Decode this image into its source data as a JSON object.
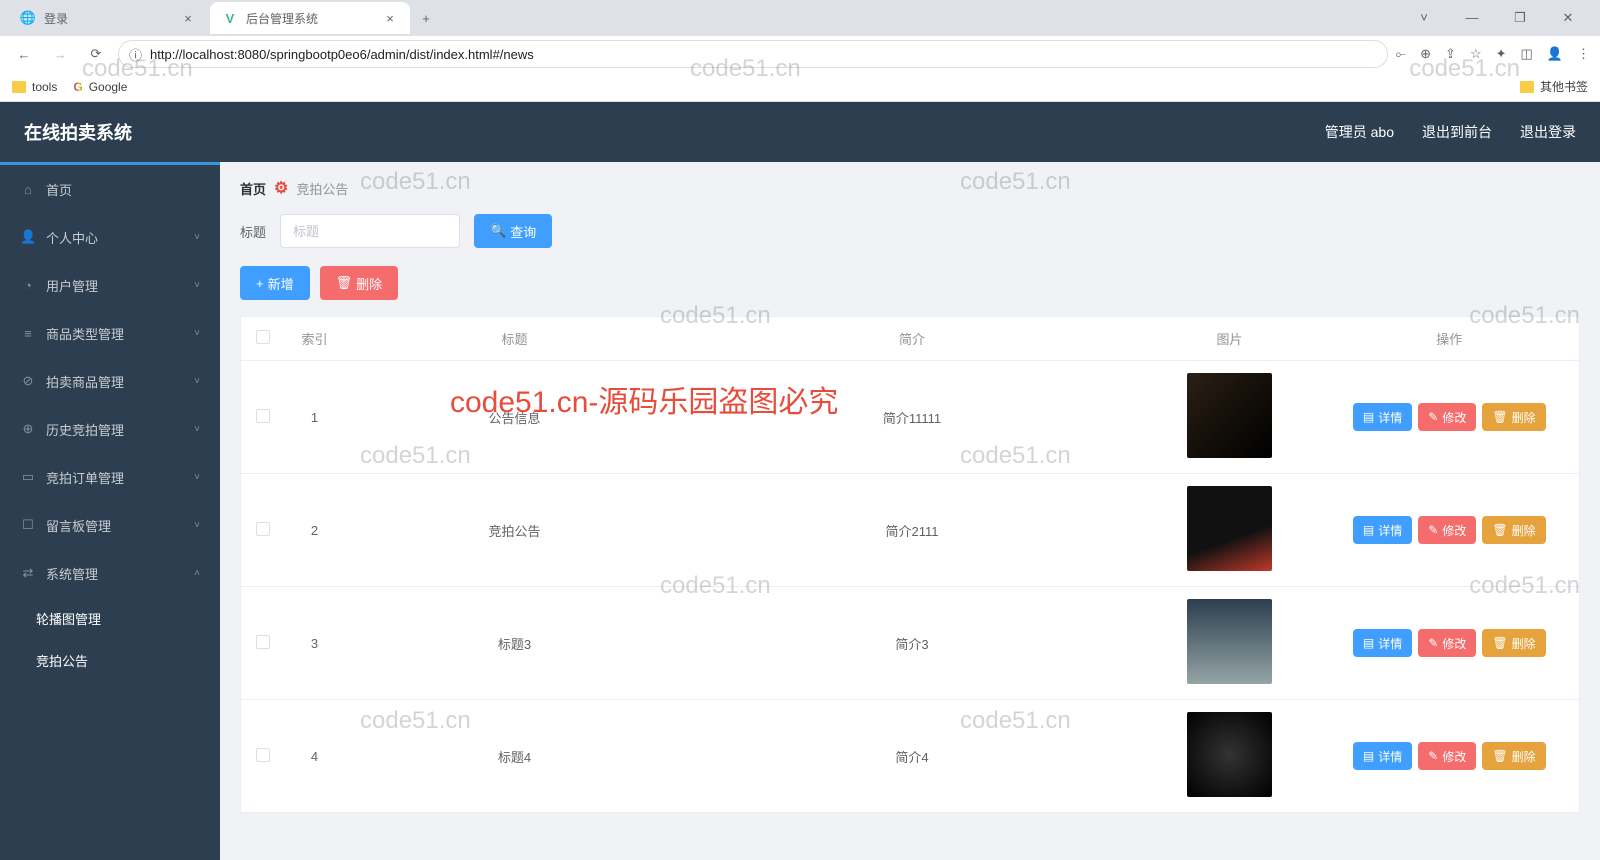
{
  "browser": {
    "tabs": [
      {
        "title": "登录",
        "active": false
      },
      {
        "title": "后台管理系统",
        "active": true
      }
    ],
    "url": "http://localhost:8080/springbootp0eo6/admin/dist/index.html#/news",
    "bookmarks": {
      "tools": "tools",
      "google": "Google",
      "other": "其他书签"
    }
  },
  "header": {
    "title": "在线拍卖系统",
    "user": "管理员 abo",
    "to_front": "退出到前台",
    "logout": "退出登录"
  },
  "sidebar": {
    "items": [
      {
        "label": "首页",
        "icon": "⌂"
      },
      {
        "label": "个人中心",
        "icon": "👤",
        "expand": true
      },
      {
        "label": "用户管理",
        "icon": "◔",
        "expand": true
      },
      {
        "label": "商品类型管理",
        "icon": "≡",
        "expand": true
      },
      {
        "label": "拍卖商品管理",
        "icon": "⊘",
        "expand": true
      },
      {
        "label": "历史竞拍管理",
        "icon": "⊕",
        "expand": true
      },
      {
        "label": "竞拍订单管理",
        "icon": "▭",
        "expand": true
      },
      {
        "label": "留言板管理",
        "icon": "☐",
        "expand": true
      },
      {
        "label": "系统管理",
        "icon": "⇄",
        "expand": true,
        "open": true
      }
    ],
    "subs": [
      {
        "label": "轮播图管理"
      },
      {
        "label": "竞拍公告"
      }
    ]
  },
  "breadcrumb": {
    "home": "首页",
    "current": "竞拍公告"
  },
  "search": {
    "label": "标题",
    "placeholder": "标题",
    "query_btn": "查询"
  },
  "actions": {
    "add": "新增",
    "delete": "删除"
  },
  "table": {
    "headers": {
      "index": "索引",
      "title": "标题",
      "intro": "简介",
      "pic": "图片",
      "ops": "操作"
    },
    "op_labels": {
      "detail": "详情",
      "edit": "修改",
      "delete": "删除"
    },
    "rows": [
      {
        "index": "1",
        "title": "公告信息",
        "intro": "简介11111",
        "img": "img-laptop"
      },
      {
        "index": "2",
        "title": "竞拍公告",
        "intro": "简介2111",
        "img": "img-pc"
      },
      {
        "index": "3",
        "title": "标题3",
        "intro": "简介3",
        "img": "img-tv"
      },
      {
        "index": "4",
        "title": "标题4",
        "intro": "简介4",
        "img": "img-watch"
      }
    ]
  },
  "watermarks": {
    "text": "code51.cn",
    "red": "code51.cn-源码乐园盗图必究"
  }
}
